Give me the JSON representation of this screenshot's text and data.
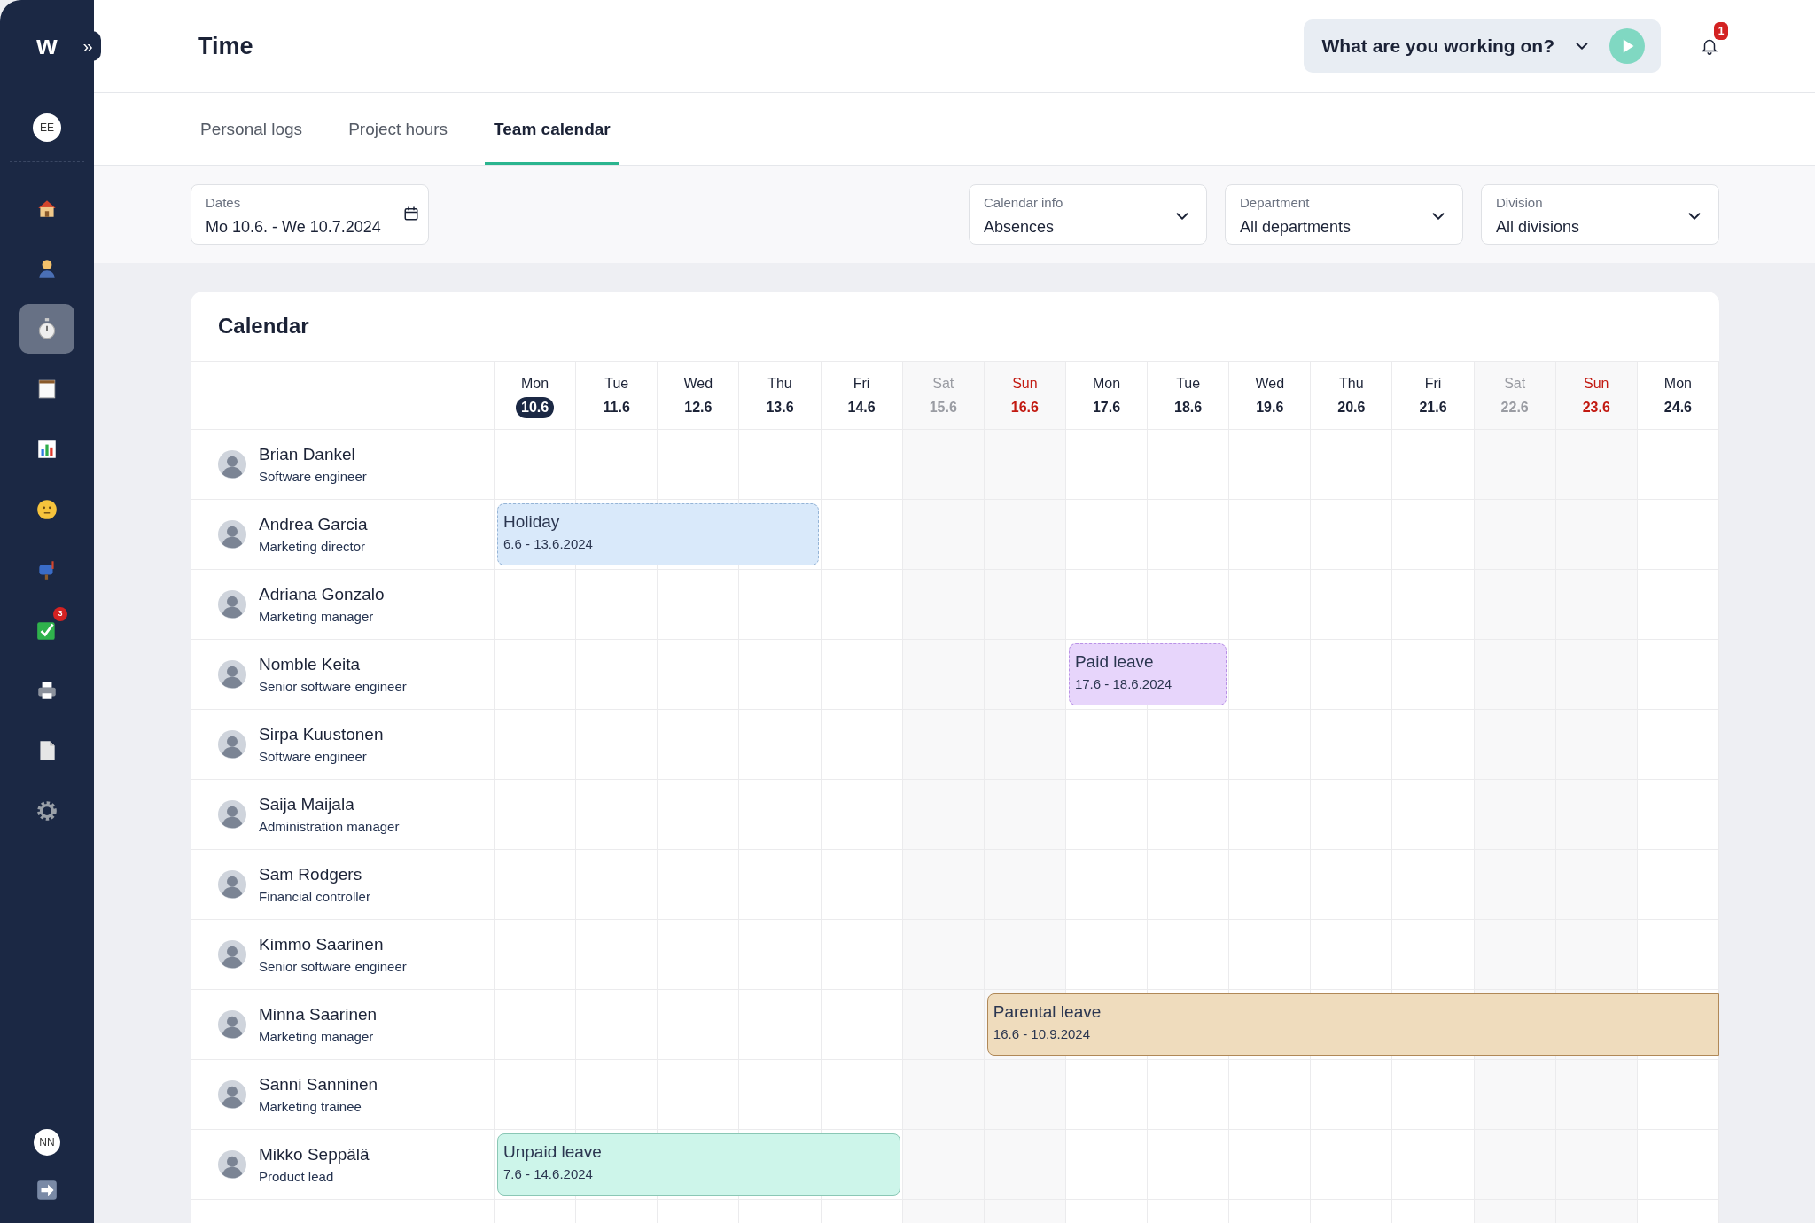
{
  "sidebar": {
    "logo": "w",
    "expand": "»",
    "user_top": "EE",
    "items": [
      {
        "selected": false
      },
      {
        "selected": false
      },
      {
        "selected": true
      },
      {
        "selected": false
      },
      {
        "selected": false
      },
      {
        "selected": false
      },
      {
        "selected": false
      },
      {
        "selected": false,
        "badge": "3"
      },
      {
        "selected": false
      },
      {
        "selected": false
      },
      {
        "selected": false
      }
    ],
    "user_bottom": "NN"
  },
  "header": {
    "title": "Time",
    "tracker": "What are you working on?",
    "notifications": "1"
  },
  "tabs": [
    {
      "label": "Personal logs",
      "selected": false
    },
    {
      "label": "Project hours",
      "selected": false
    },
    {
      "label": "Team calendar",
      "selected": true
    }
  ],
  "filters": {
    "dates": {
      "label": "Dates",
      "value": "Mo 10.6. - We 10.7.2024"
    },
    "selects": [
      {
        "label": "Calendar info",
        "value": "Absences"
      },
      {
        "label": "Department",
        "value": "All departments"
      },
      {
        "label": "Division",
        "value": "All divisions"
      }
    ]
  },
  "calendar": {
    "title": "Calendar",
    "days": [
      {
        "weekday": "Mon",
        "date": "10.6",
        "kind": "weekday",
        "today": true
      },
      {
        "weekday": "Tue",
        "date": "11.6",
        "kind": "weekday",
        "today": false
      },
      {
        "weekday": "Wed",
        "date": "12.6",
        "kind": "weekday",
        "today": false
      },
      {
        "weekday": "Thu",
        "date": "13.6",
        "kind": "weekday",
        "today": false
      },
      {
        "weekday": "Fri",
        "date": "14.6",
        "kind": "weekday",
        "today": false
      },
      {
        "weekday": "Sat",
        "date": "15.6",
        "kind": "saturday",
        "today": false
      },
      {
        "weekday": "Sun",
        "date": "16.6",
        "kind": "sunday",
        "today": false
      },
      {
        "weekday": "Mon",
        "date": "17.6",
        "kind": "weekday",
        "today": false
      },
      {
        "weekday": "Tue",
        "date": "18.6",
        "kind": "weekday",
        "today": false
      },
      {
        "weekday": "Wed",
        "date": "19.6",
        "kind": "weekday",
        "today": false
      },
      {
        "weekday": "Thu",
        "date": "20.6",
        "kind": "weekday",
        "today": false
      },
      {
        "weekday": "Fri",
        "date": "21.6",
        "kind": "weekday",
        "today": false
      },
      {
        "weekday": "Sat",
        "date": "22.6",
        "kind": "saturday",
        "today": false
      },
      {
        "weekday": "Sun",
        "date": "23.6",
        "kind": "sunday",
        "today": false
      },
      {
        "weekday": "Mon",
        "date": "24.6",
        "kind": "weekday",
        "today": false
      }
    ],
    "people": [
      {
        "name": "Brian Dankel",
        "role": "Software engineer"
      },
      {
        "name": "Andrea Garcia",
        "role": "Marketing director",
        "absence": {
          "kind": "holiday",
          "title": "Holiday",
          "dates": "6.6 - 13.6.2024",
          "days": [
            true,
            true,
            true,
            true,
            false,
            false,
            false,
            false,
            false,
            false,
            false,
            false,
            false,
            false,
            false
          ]
        }
      },
      {
        "name": "Adriana Gonzalo",
        "role": "Marketing manager"
      },
      {
        "name": "Nomble Keita",
        "role": "Senior software engineer",
        "absence": {
          "kind": "paid",
          "title": "Paid leave",
          "dates": "17.6 - 18.6.2024",
          "days": [
            false,
            false,
            false,
            false,
            false,
            false,
            false,
            true,
            true,
            false,
            false,
            false,
            false,
            false,
            false
          ]
        }
      },
      {
        "name": "Sirpa Kuustonen",
        "role": "Software engineer"
      },
      {
        "name": "Saija Maijala",
        "role": "Administration manager"
      },
      {
        "name": "Sam Rodgers",
        "role": "Financial controller"
      },
      {
        "name": "Kimmo Saarinen",
        "role": "Senior software engineer"
      },
      {
        "name": "Minna Saarinen",
        "role": "Marketing manager",
        "absence": {
          "kind": "parental",
          "title": "Parental leave",
          "dates": "16.6 - 10.9.2024",
          "days": [
            false,
            false,
            false,
            false,
            false,
            false,
            true,
            true,
            true,
            true,
            true,
            true,
            true,
            true,
            true
          ]
        }
      },
      {
        "name": "Sanni Sanninen",
        "role": "Marketing trainee"
      },
      {
        "name": "Mikko Seppälä",
        "role": "Product lead",
        "absence": {
          "kind": "unpaid",
          "title": "Unpaid leave",
          "dates": "7.6 - 14.6.2024",
          "days": [
            true,
            true,
            true,
            true,
            true,
            false,
            false,
            false,
            false,
            false,
            false,
            false,
            false,
            false,
            false
          ]
        }
      }
    ]
  }
}
